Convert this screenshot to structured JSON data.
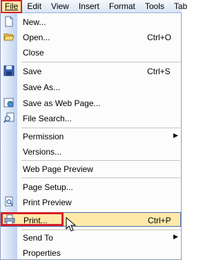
{
  "menubar": {
    "items": [
      {
        "label": "File"
      },
      {
        "label": "Edit"
      },
      {
        "label": "View"
      },
      {
        "label": "Insert"
      },
      {
        "label": "Format"
      },
      {
        "label": "Tools"
      },
      {
        "label": "Tab"
      }
    ]
  },
  "file_menu": {
    "new": {
      "label": "New...",
      "icon": "new-document-icon"
    },
    "open": {
      "label": "Open...",
      "shortcut": "Ctrl+O",
      "icon": "open-folder-icon"
    },
    "close": {
      "label": "Close"
    },
    "save": {
      "label": "Save",
      "shortcut": "Ctrl+S",
      "icon": "save-disk-icon"
    },
    "save_as": {
      "label": "Save As..."
    },
    "save_web": {
      "label": "Save as Web Page...",
      "icon": "web-page-icon"
    },
    "file_search": {
      "label": "File Search...",
      "icon": "file-search-icon"
    },
    "permission": {
      "label": "Permission",
      "submenu_arrow": "▶"
    },
    "versions": {
      "label": "Versions..."
    },
    "web_preview": {
      "label": "Web Page Preview"
    },
    "page_setup": {
      "label": "Page Setup..."
    },
    "print_preview": {
      "label": "Print Preview",
      "icon": "print-preview-icon"
    },
    "print": {
      "label": "Print...",
      "shortcut": "Ctrl+P",
      "icon": "printer-icon"
    },
    "send_to": {
      "label": "Send To",
      "submenu_arrow": "▶"
    },
    "properties": {
      "label": "Properties"
    }
  },
  "colors": {
    "highlight_border": "#d5202a",
    "hover_fill": "#ffe9a8",
    "gutter": "#bfd2f0"
  }
}
